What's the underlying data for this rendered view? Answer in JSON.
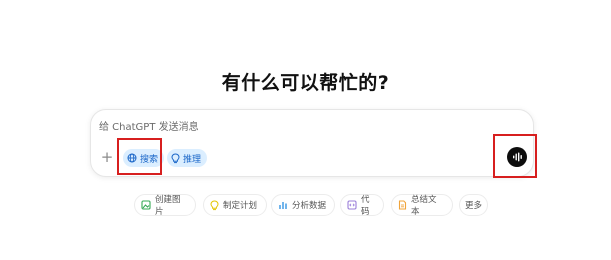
{
  "headline": "有什么可以帮忙的?",
  "composer": {
    "placeholder": "给 ChatGPT 发送消息",
    "plus_icon": "+",
    "search_label": "搜索",
    "reason_label": "推理",
    "voice_icon": "voice-waveform-icon"
  },
  "suggestions": [
    {
      "label": "创建图片",
      "icon": "image-icon",
      "color": "#34a853"
    },
    {
      "label": "制定计划",
      "icon": "lightbulb-icon",
      "color": "#e3c500"
    },
    {
      "label": "分析数据",
      "icon": "bar-chart-icon",
      "color": "#4fa3e8"
    },
    {
      "label": "代码",
      "icon": "code-icon",
      "color": "#9b7fd9"
    },
    {
      "label": "总结文本",
      "icon": "document-icon",
      "color": "#f0a43a"
    },
    {
      "label": "更多"
    }
  ],
  "colors": {
    "pill_bg": "#dbeeff",
    "pill_text": "#1a66c8",
    "highlight": "#d71f1f"
  }
}
